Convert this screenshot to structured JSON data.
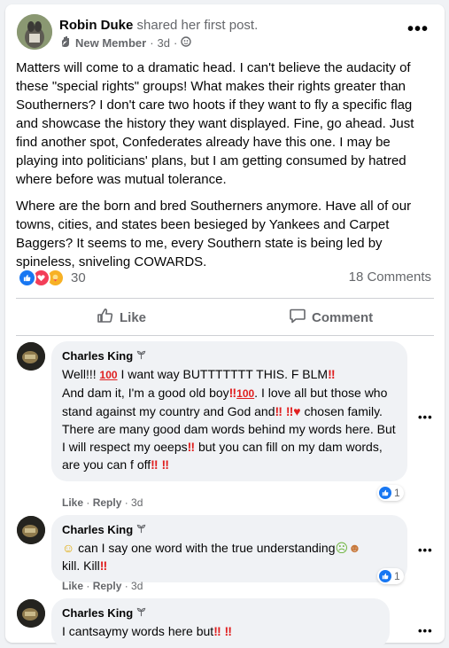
{
  "post": {
    "author": "Robin Duke",
    "action": "shared her first post.",
    "badge": "New Member",
    "time": "3d",
    "paragraphs": [
      "Matters will come to a dramatic head.  I can't believe the audacity of these \"special rights\" groups!  What makes their rights greater than Southerners?  I don't care two hoots if they want to fly a specific flag and showcase the history they want displayed.  Fine, go ahead.  Just find another spot, Confederates already have this one.  I may be playing into politicians' plans, but I am getting consumed by hatred where before was mutual tolerance.",
      "Where are the born and bred Southerners anymore.  Have all of our towns, cities, and states been besieged by Yankees and Carpet Baggers?  It seems to me, every Southern state is being led by spineless, sniveling COWARDS."
    ],
    "reaction_count": "30",
    "comments_count": "18 Comments",
    "like_label": "Like",
    "comment_label": "Comment"
  },
  "comments": [
    {
      "name": "Charles King",
      "text_1": "Well!!! ",
      "text_2": " I want way BUTTTTTTT THIS. F BLM",
      "text_3": "And dam it, I'm a good old boy",
      "text_4": " I love all but those who stand against my country and God and",
      "text_5": " chosen family.",
      "text_6": "There are many good dam words behind my words here. But I will respect my oeeps",
      "text_7": " but you can fill on my dam words, are you can f off",
      "hundred": "100",
      "like_label": "Like",
      "reply_label": "Reply",
      "time": "3d",
      "likes": "1"
    },
    {
      "name": "Charles King",
      "text_1": " can I say one word with the true understanding",
      "text_2": " kill. Kill",
      "like_label": "Like",
      "reply_label": "Reply",
      "time": "3d",
      "likes": "1"
    },
    {
      "name": "Charles King",
      "text_1": "I cantsaymy words here but"
    }
  ],
  "icons": {
    "more": "more-dots-icon",
    "like": "thumbs-up-icon",
    "comment": "comment-bubble-icon"
  },
  "colors": {
    "brand_blue": "#1877f2",
    "muted_text": "#65676b",
    "bubble_bg": "#f0f2f5",
    "alert_red": "#e02020"
  }
}
